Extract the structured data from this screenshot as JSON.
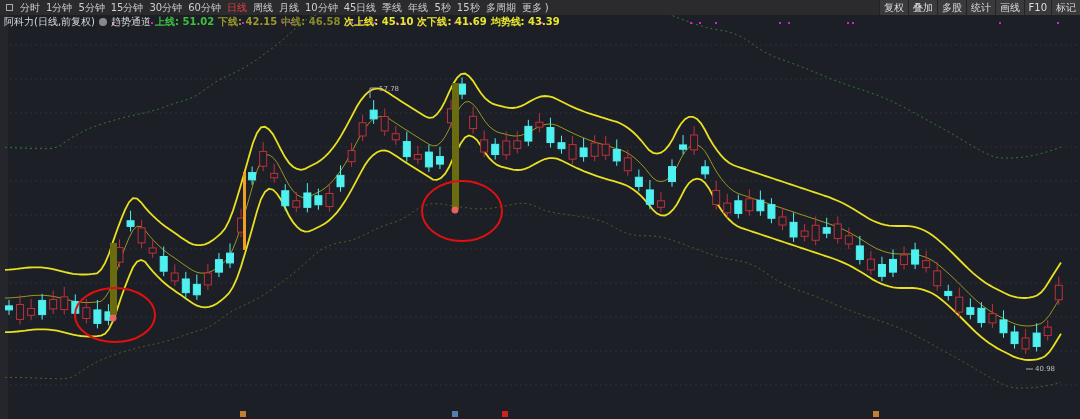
{
  "toolbar": {
    "periods": [
      {
        "label": "分时",
        "selected": false
      },
      {
        "label": "1分钟",
        "selected": false
      },
      {
        "label": "5分钟",
        "selected": false
      },
      {
        "label": "15分钟",
        "selected": false
      },
      {
        "label": "30分钟",
        "selected": false
      },
      {
        "label": "60分钟",
        "selected": false
      },
      {
        "label": "日线",
        "selected": true
      },
      {
        "label": "周线",
        "selected": false
      },
      {
        "label": "月线",
        "selected": false
      },
      {
        "label": "10分钟",
        "selected": false
      },
      {
        "label": "45日线",
        "selected": false
      },
      {
        "label": "季线",
        "selected": false
      },
      {
        "label": "年线",
        "selected": false
      },
      {
        "label": "5秒",
        "selected": false
      },
      {
        "label": "15秒",
        "selected": false
      },
      {
        "label": "多周期",
        "selected": false
      },
      {
        "label": "更多 )",
        "selected": false
      }
    ],
    "tools": [
      "复权",
      "叠加",
      "多股",
      "统计",
      "画线",
      "F10",
      "标记"
    ]
  },
  "legend": {
    "title": "阿科力(日线,前复权)",
    "indicator": "趋势通道",
    "values": [
      {
        "label": "上线:",
        "value": "51.02",
        "color": "#3fbf3f"
      },
      {
        "label": "下线:",
        "value": "42.15",
        "color": "#9a9a2a"
      },
      {
        "label": "中线:",
        "value": "46.58",
        "color": "#8a8a2a"
      },
      {
        "label": "次上线:",
        "value": "45.10",
        "color": "#e8e82a"
      },
      {
        "label": "次下线:",
        "value": "41.69",
        "color": "#e8e82a"
      },
      {
        "label": "均势线:",
        "value": "43.39",
        "color": "#e8e82a"
      }
    ]
  },
  "chart": {
    "high_label": "57.78",
    "low_label": "40.98"
  }
}
